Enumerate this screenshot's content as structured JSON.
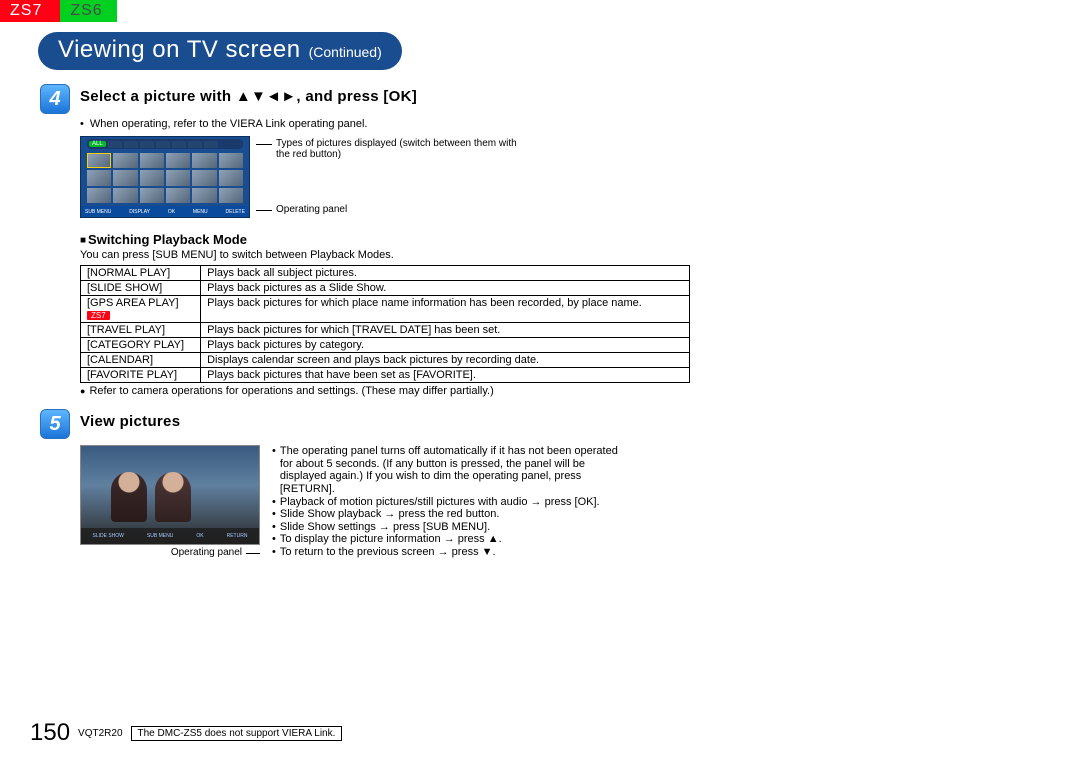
{
  "header": {
    "tab_zs7": "ZS7",
    "tab_zs6": "ZS6"
  },
  "title": {
    "main": "Viewing on TV screen",
    "sub": "(Continued)"
  },
  "step4": {
    "num": "4",
    "title_pre": "Select a picture with ",
    "title_post": ", and press [OK]",
    "bullet": "When operating, refer to the VIERA Link operating panel.",
    "all_label": "ALL",
    "annot_top": "Types of pictures displayed (switch between them with the red button)",
    "annot_bot": "Operating panel"
  },
  "switch": {
    "heading": "Switching Playback Mode",
    "sub": "You can press [SUB MENU] to switch between Playback Modes.",
    "rows": [
      {
        "name": "[NORMAL PLAY]",
        "desc": "Plays back all subject pictures.",
        "zs7": false
      },
      {
        "name": "[SLIDE SHOW]",
        "desc": "Plays back pictures as a Slide Show.",
        "zs7": false
      },
      {
        "name": "[GPS AREA PLAY]",
        "desc": "Plays back pictures for which place name information has been recorded, by place name.",
        "zs7": true
      },
      {
        "name": "[TRAVEL PLAY]",
        "desc": "Plays back pictures for which [TRAVEL DATE] has been set.",
        "zs7": false
      },
      {
        "name": "[CATEGORY PLAY]",
        "desc": "Plays back pictures by category.",
        "zs7": false
      },
      {
        "name": "[CALENDAR]",
        "desc": "Displays calendar screen and plays back pictures by recording date.",
        "zs7": false
      },
      {
        "name": "[FAVORITE PLAY]",
        "desc": "Plays back pictures that have been set as [FAVORITE].",
        "zs7": false
      }
    ],
    "note": "Refer to camera operations for operations and settings. (These may differ partially.)"
  },
  "step5": {
    "num": "5",
    "title": "View pictures",
    "op_caption": "Operating panel",
    "notes": [
      "The operating panel turns off automatically if it has not been operated for about 5 seconds. (If any button is pressed, the panel will be displayed again.) If you wish to dim the operating panel, press [RETURN].",
      "Playback of motion pictures/still pictures with audio → press [OK].",
      "Slide Show playback → press the red button.",
      "Slide Show settings → press [SUB MENU].",
      "To display the picture information → press ▲.",
      "To return to the previous screen → press ▼."
    ]
  },
  "footer": {
    "page": "150",
    "code": "VQT2R20",
    "note": "The DMC-ZS5 does not support VIERA Link.",
    "zs7_chip": "ZS7"
  }
}
